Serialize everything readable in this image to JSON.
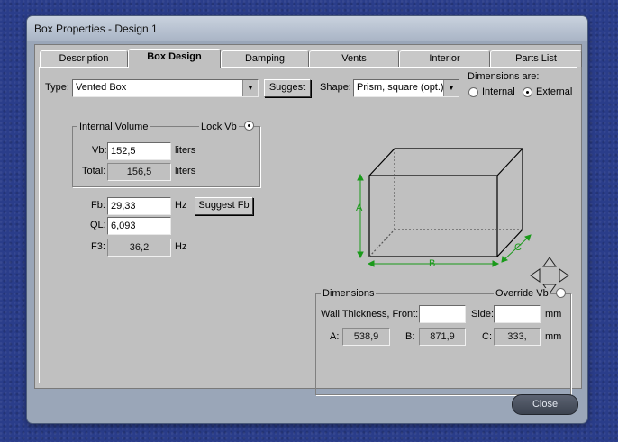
{
  "window": {
    "title": "Box Properties - Design 1"
  },
  "tabs": [
    {
      "label": "Description",
      "active": false
    },
    {
      "label": "Box Design",
      "active": true
    },
    {
      "label": "Damping",
      "active": false
    },
    {
      "label": "Vents",
      "active": false
    },
    {
      "label": "Interior",
      "active": false
    },
    {
      "label": "Parts List",
      "active": false
    }
  ],
  "type": {
    "label": "Type:",
    "value": "Vented Box",
    "suggest_label": "Suggest"
  },
  "shape": {
    "label": "Shape:",
    "value": "Prism, square (opt.)"
  },
  "dimensions_are": {
    "label": "Dimensions are:",
    "internal_label": "Internal",
    "external_label": "External",
    "selected": "External"
  },
  "internal_volume": {
    "group_label": "Internal Volume",
    "lock_label": "Lock Vb",
    "lock_checked": true,
    "vb_label": "Vb:",
    "vb_value": "152,5",
    "vb_unit": "liters",
    "total_label": "Total:",
    "total_value": "156,5",
    "total_unit": "liters"
  },
  "tuning": {
    "fb_label": "Fb:",
    "fb_value": "29,33",
    "fb_unit": "Hz",
    "suggest_fb_label": "Suggest Fb",
    "ql_label": "QL:",
    "ql_value": "6,093",
    "f3_label": "F3:",
    "f3_value": "36,2",
    "f3_unit": "Hz"
  },
  "diagram": {
    "a_label": "A",
    "b_label": "B",
    "c_label": "C",
    "color": "#1a9a1a"
  },
  "dimensions": {
    "group_label": "Dimensions",
    "override_label": "Override Vb",
    "override_checked": false,
    "wall_front_label": "Wall Thickness, Front:",
    "wall_front_value": "",
    "side_label": "Side:",
    "side_value": "",
    "mm_label": "mm",
    "a_label": "A:",
    "a_value": "538,9",
    "b_label": "B:",
    "b_value": "871,9",
    "c_label": "C:",
    "c_value": "333,",
    "mm2_label": "mm"
  },
  "footer": {
    "close_label": "Close"
  }
}
